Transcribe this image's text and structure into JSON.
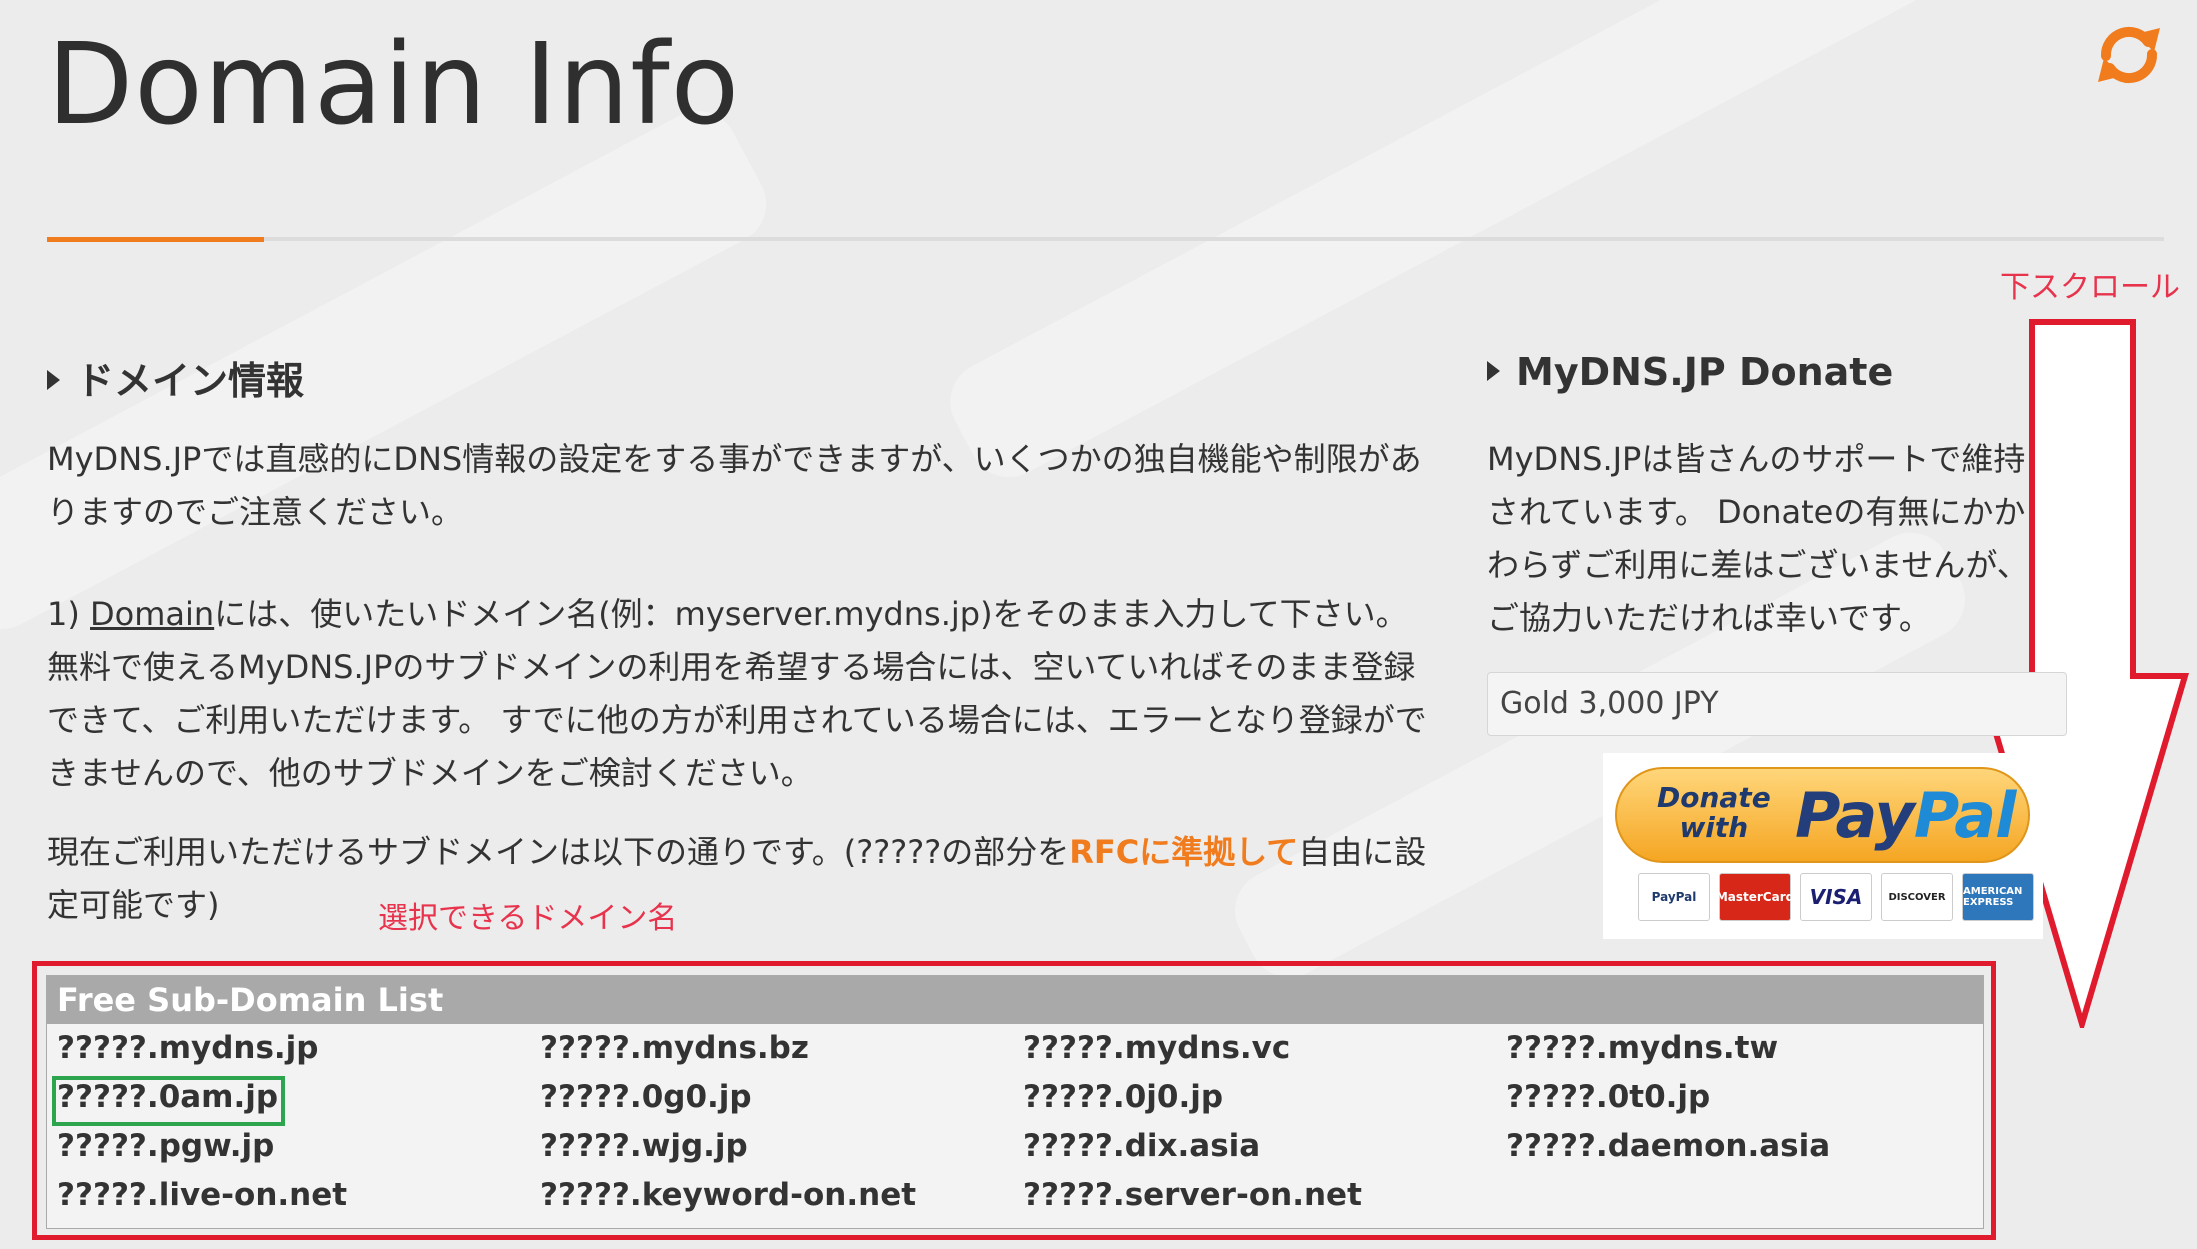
{
  "header": {
    "title": "Domain Info"
  },
  "scroll_hint": "下スクロール",
  "domain_section": {
    "heading": "ドメイン情報",
    "intro": "MyDNS.JPでは直感的にDNS情報の設定をする事ができますが、いくつかの独自機能や制限がありますのでご注意ください。",
    "item1_prefix": "1) ",
    "item1_link": "Domain",
    "item1_rest": "には、使いたいドメイン名(例：myserver.mydns.jp)をそのまま入力して下さい。 無料で使えるMyDNS.JPのサブドメインの利用を希望する場合には、空いていればそのまま登録できて、ご利用いただけます。 すでに他の方が利用されている場合には、エラーとなり登録ができませんので、他のサブドメインをご検討ください。",
    "available_prefix": "現在ご利用いただけるサブドメインは以下の通りです。(?????の部分を",
    "available_link": "RFCに準拠して",
    "available_suffix": "自由に設定可能です)",
    "selectable_label": "選択できるドメイン名"
  },
  "donate_section": {
    "heading": "MyDNS.JP Donate",
    "text": "MyDNS.JPは皆さんのサポートで維持されています。 Donateの有無にかかわらずご利用に差はございませんが、ご協力いただければ幸いです。",
    "selected_option": "Gold 3,000 JPY",
    "paypal_donate": "Donate",
    "paypal_with": "with",
    "paypal_pay": "Pay",
    "paypal_pal": "Pal",
    "cards": [
      "PayPal",
      "MasterCard",
      "VISA",
      "DISCOVER",
      "AMERICAN EXPRESS"
    ]
  },
  "subdomain_list": {
    "header": "Free Sub-Domain List",
    "items": [
      "?????.mydns.jp",
      "?????.mydns.bz",
      "?????.mydns.vc",
      "?????.mydns.tw",
      "?????.0am.jp",
      "?????.0g0.jp",
      "?????.0j0.jp",
      "?????.0t0.jp",
      "?????.pgw.jp",
      "?????.wjg.jp",
      "?????.dix.asia",
      "?????.daemon.asia",
      "?????.live-on.net",
      "?????.keyword-on.net",
      "?????.server-on.net",
      ""
    ]
  },
  "colors": {
    "accent_orange": "#f07c1e",
    "annotation_red": "#e01b2e",
    "highlight_green": "#2da44e",
    "list_header_gray": "#a9a9a9"
  },
  "icons": [
    "refresh-icon",
    "down-arrow-annotation"
  ]
}
